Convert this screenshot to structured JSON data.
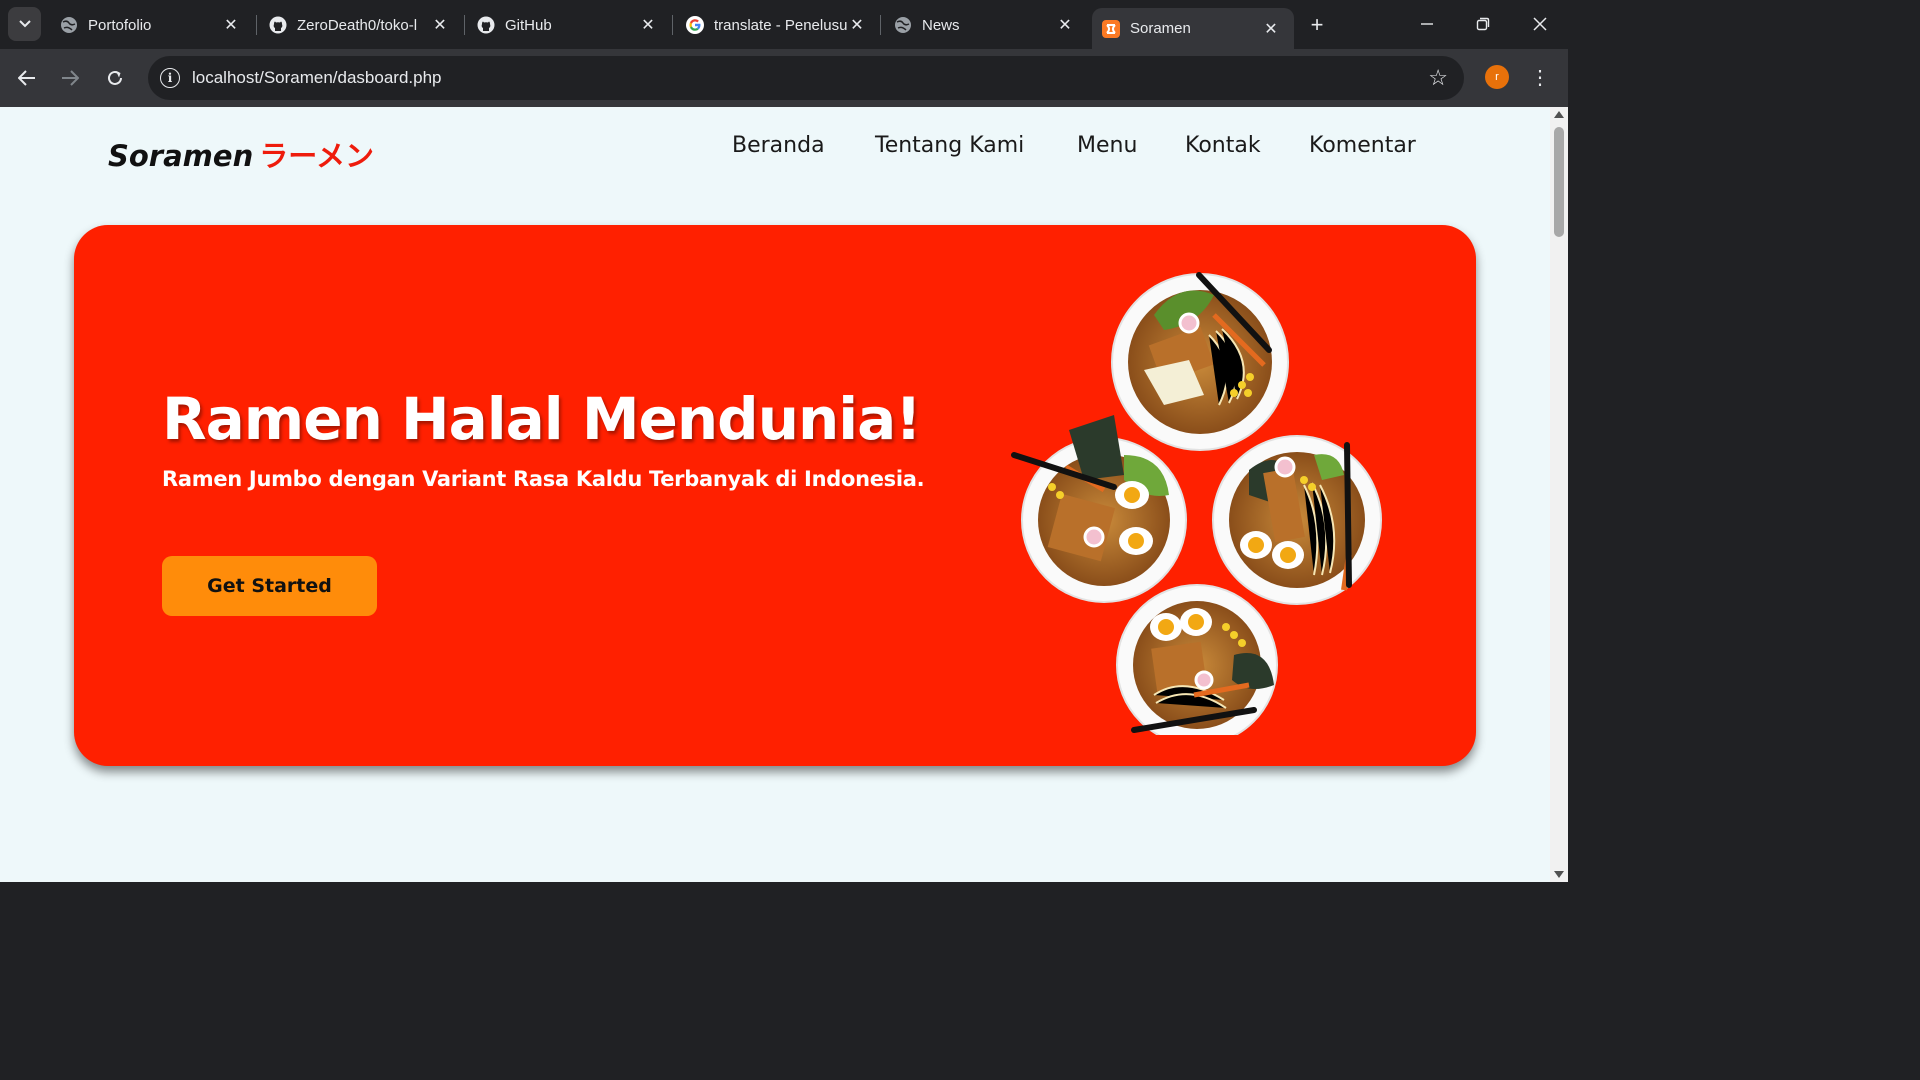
{
  "browser": {
    "tabs": [
      {
        "title": "Portofolio",
        "icon": "globe-icon"
      },
      {
        "title": "ZeroDeath0/toko-l",
        "icon": "github-icon"
      },
      {
        "title": "GitHub",
        "icon": "github-icon"
      },
      {
        "title": "translate - Penelusu",
        "icon": "google-icon"
      },
      {
        "title": "News",
        "icon": "globe-icon"
      },
      {
        "title": "Soramen",
        "icon": "xampp-icon"
      }
    ],
    "active_tab": 5,
    "url": "localhost/Soramen/dasboard.php",
    "profile_initial": "r"
  },
  "site": {
    "brand": "Soramen",
    "brand_jp": "ラーメン",
    "nav": [
      "Beranda",
      "Tentang Kami",
      "Menu",
      "Kontak",
      "Komentar"
    ]
  },
  "hero": {
    "title": "Ramen Halal Mendunia!",
    "subtitle": "Ramen Jumbo dengan Variant Rasa Kaldu Terbanyak di Indonesia.",
    "cta": "Get Started"
  },
  "colors": {
    "hero_bg": "#ff2000",
    "cta_bg": "#ff8c0a",
    "page_bg": "#eef8fa",
    "brand_accent": "#ee1c0c"
  }
}
